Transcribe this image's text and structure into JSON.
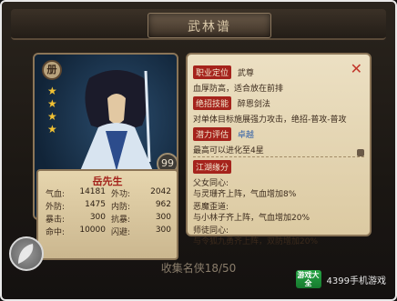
{
  "header": {
    "title": "武林谱"
  },
  "hero": {
    "name": "岳先生",
    "level": "99",
    "badge_icon": "book-icon",
    "stars": 4,
    "stats": [
      {
        "k": "气血:",
        "v": "14181"
      },
      {
        "k": "外功:",
        "v": "2042"
      },
      {
        "k": "外防:",
        "v": "1475"
      },
      {
        "k": "内防:",
        "v": "962"
      },
      {
        "k": "暴击:",
        "v": "300"
      },
      {
        "k": "抗暴:",
        "v": "300"
      },
      {
        "k": "命中:",
        "v": "10000"
      },
      {
        "k": "闪避:",
        "v": "300"
      }
    ]
  },
  "info": {
    "role_label": "职业定位",
    "role_value": "武尊",
    "role_desc": "血厚防高，适合放在前排",
    "skill_label": "绝招技能",
    "skill_value": "醉恩剑法",
    "skill_desc": "对单体目标施展强力攻击，绝招-普攻-普攻",
    "potential_label": "潜力评估",
    "potential_value": "卓越",
    "potential_desc": "最高可以进化至4星",
    "fate_label": "江湖缘分",
    "fates": [
      {
        "title": "父女同心:",
        "desc": "与灵珊齐上阵，气血增加8%"
      },
      {
        "title": "恶魔歪道:",
        "desc": "与小林子齐上阵，气血增加20%"
      },
      {
        "title": "师徒同心:",
        "desc": "与令狐九勇齐上阵，双防增加20%"
      }
    ]
  },
  "footer": {
    "collect_text": "收集名侠18/50"
  },
  "watermark": {
    "logo_text": "游戏大全",
    "site_text": "4399手机游戏"
  }
}
